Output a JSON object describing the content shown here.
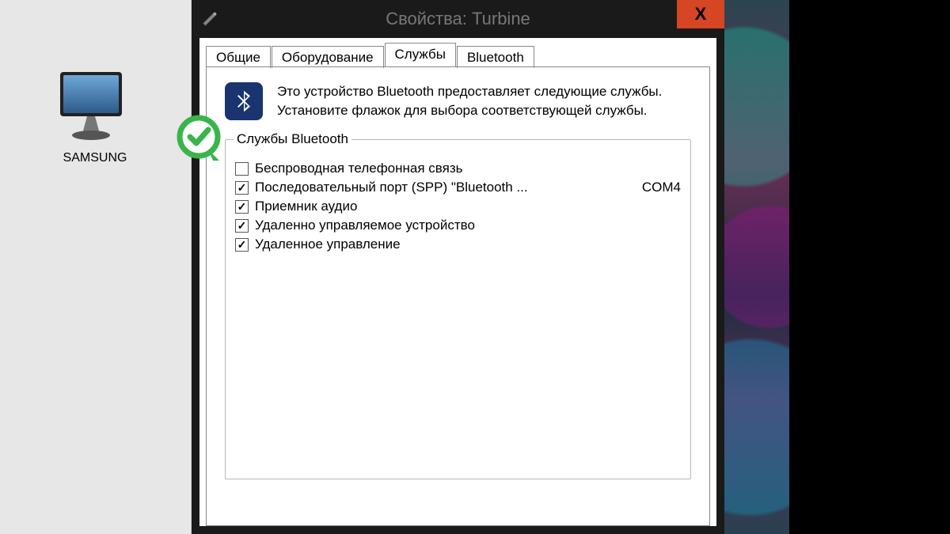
{
  "desktop": {
    "icon_label": "SAMSUNG"
  },
  "dialog": {
    "title": "Свойства: Turbine",
    "close_label": "X",
    "tabs": [
      {
        "label": "Общие"
      },
      {
        "label": "Оборудование"
      },
      {
        "label": "Службы"
      },
      {
        "label": "Bluetooth"
      }
    ],
    "active_tab_index": 2,
    "intro": "Это устройство Bluetooth предоставляет следующие службы. Установите флажок для выбора соответствующей службы.",
    "group_title": "Службы Bluetooth",
    "services": [
      {
        "checked": false,
        "label": "Беспроводная телефонная связь",
        "extra": ""
      },
      {
        "checked": true,
        "label": "Последовательный порт (SPP) \"Bluetooth ...",
        "extra": "COM4"
      },
      {
        "checked": true,
        "label": "Приемник аудио",
        "extra": ""
      },
      {
        "checked": true,
        "label": "Удаленно управляемое устройство",
        "extra": ""
      },
      {
        "checked": true,
        "label": "Удаленное управление",
        "extra": ""
      }
    ]
  }
}
